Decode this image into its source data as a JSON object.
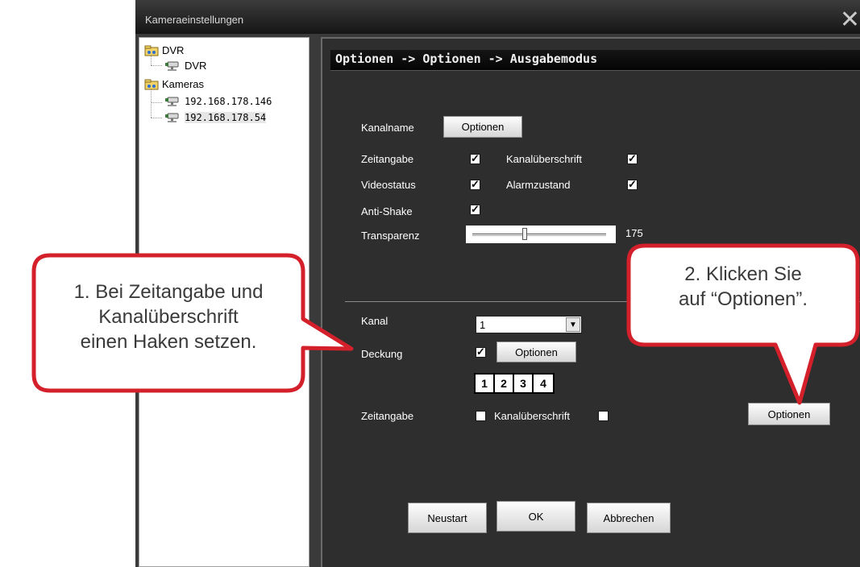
{
  "window": {
    "title": "Kameraeinstellungen",
    "close_glyph": "✕"
  },
  "tree": {
    "items": [
      {
        "label": "DVR",
        "type": "folder"
      },
      {
        "label": "DVR",
        "type": "camera"
      },
      {
        "label": "Kameras",
        "type": "folder"
      },
      {
        "label": "192.168.178.146",
        "type": "camera"
      },
      {
        "label": "192.168.178.54",
        "type": "camera",
        "selected": true
      }
    ]
  },
  "panel": {
    "breadcrumb": "Optionen -> Optionen -> Ausgabemodus",
    "kanalname_label": "Kanalname",
    "kanalname_button": "Optionen",
    "zeitangabe_label": "Zeitangabe",
    "zeitangabe_checked": true,
    "kanalueberschrift_label": "Kanalüberschrift",
    "kanalueberschrift_checked": true,
    "videostatus_label": "Videostatus",
    "videostatus_checked": true,
    "alarmzustand_label": "Alarmzustand",
    "alarmzustand_checked": true,
    "antishake_label": "Anti-Shake",
    "antishake_checked": true,
    "transparenz_label": "Transparenz",
    "transparenz_value": "175",
    "kanal_label": "Kanal",
    "kanal_value": "1",
    "deckung_label": "Deckung",
    "deckung_checked": true,
    "deckung_button": "Optionen",
    "numbers": [
      "1",
      "2",
      "3",
      "4"
    ],
    "zeitangabe2_label": "Zeitangabe",
    "zeitangabe2_checked": false,
    "kanalueberschrift2_label": "Kanalüberschrift",
    "kanalueberschrift2_checked": false,
    "optionen_button": "Optionen",
    "neustart_button": "Neustart",
    "ok_button": "OK",
    "abbrechen_button": "Abbrechen"
  },
  "callouts": {
    "left": [
      "1. Bei Zeitangabe und",
      "Kanalüberschrift",
      "einen Haken setzen."
    ],
    "right": [
      "2. Klicken Sie",
      "auf “Optionen”."
    ],
    "color": "#d3202a"
  }
}
